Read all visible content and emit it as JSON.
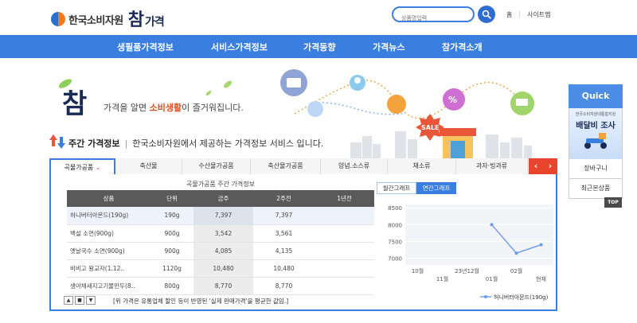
{
  "header": {
    "org": "한국소비자원",
    "brand_main": "참",
    "brand_sub": "가격",
    "search_placeholder": "상품명입력",
    "util_links": [
      "홈",
      "사이트맵"
    ]
  },
  "nav": [
    "생필품가격정보",
    "서비스가격정보",
    "가격동향",
    "가격뉴스",
    "참가격소개"
  ],
  "banner": {
    "script": "참",
    "slogan_pre": "가격을 알면 ",
    "slogan_highlight": "소비생활",
    "slogan_post": "이 즐거워집니다.",
    "sale_badge": "SALE"
  },
  "weekly": {
    "title": "주간 가격정보",
    "desc": "한국소비자원에서 제공하는 가격정보 서비스 입니다."
  },
  "quick": {
    "title": "Quick",
    "ad_small": "한국소비자원대통합지원",
    "ad_big": "배달비 조사",
    "links": [
      "장바구니",
      "최근본상품"
    ],
    "top": "TOP"
  },
  "tabs": [
    "곡물가공품",
    "축산물",
    "수산물가공품",
    "축산물가공품",
    "양념.소스류",
    "채소류",
    "과자·빙과류"
  ],
  "tab_arrows": [
    "‹",
    "›"
  ],
  "table": {
    "title": "곡물가공품 주간 가격정보",
    "headers": [
      "상품",
      "단위",
      "금주",
      "2주전",
      "1년전"
    ],
    "rows": [
      {
        "name": "허니버터아몬드(190g)",
        "unit": "190g",
        "this_week": "7,397",
        "two_weeks": "7,397",
        "year_ago": ""
      },
      {
        "name": "백설 소면(900g)",
        "unit": "900g",
        "this_week": "3,542",
        "two_weeks": "3,561",
        "year_ago": ""
      },
      {
        "name": "옛날국수 소면(900g)",
        "unit": "900g",
        "this_week": "4,085",
        "two_weeks": "4,135",
        "year_ago": ""
      },
      {
        "name": "비비고 왕교자(1.12..",
        "unit": "1120g",
        "this_week": "10,480",
        "two_weeks": "10,480",
        "year_ago": ""
      },
      {
        "name": "생야채새지고기물만두(8..",
        "unit": "800g",
        "this_week": "8,770",
        "two_weeks": "8,770",
        "year_ago": ""
      }
    ]
  },
  "pager": [
    "▲",
    "■",
    "▼"
  ],
  "note": "[위 가격은 유통업체 할인 등이 반영된 '실제 판매가격'을 평균한 값임.]",
  "chart_tabs": [
    "월간그래프",
    "연간그래프"
  ],
  "chart_data": {
    "type": "line",
    "title": "",
    "xlabel": "",
    "ylabel": "",
    "categories": [
      "10월",
      "11월",
      "23년12월",
      "01월",
      "02월",
      "현재"
    ],
    "series": [
      {
        "name": "허니버터아몬드(190g)",
        "values": [
          null,
          null,
          null,
          8000,
          7150,
          7400
        ]
      }
    ],
    "ylim": [
      6800,
      8600
    ],
    "yticks": [
      7000,
      7500,
      8000,
      8500
    ],
    "grid": true,
    "legend": "bottom",
    "color": "#6a9be8"
  }
}
